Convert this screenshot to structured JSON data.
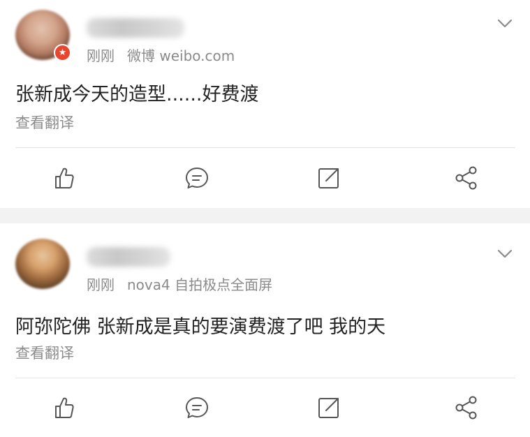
{
  "posts": [
    {
      "username": "",
      "time": "刚刚",
      "source": "微博 weibo.com",
      "text": "张新成今天的造型......好费渡",
      "translate_label": "查看翻译",
      "avatar_badge": "★",
      "icons": {
        "dropdown": "chevron-down-icon",
        "like": "thumbs-up-icon",
        "comment": "comment-bubble-icon",
        "repost": "repost-icon",
        "share": "share-icon"
      }
    },
    {
      "username": "",
      "time": "刚刚",
      "source": "nova4 自拍极点全面屏",
      "text": "阿弥陀佛 张新成是真的要演费渡了吧 我的天",
      "translate_label": "查看翻译",
      "icons": {
        "dropdown": "chevron-down-icon",
        "like": "thumbs-up-icon",
        "comment": "comment-bubble-icon",
        "repost": "repost-icon",
        "share": "share-icon"
      }
    }
  ],
  "colors": {
    "text_primary": "#222222",
    "text_secondary": "#8a8a8a",
    "icon": "#555555",
    "separator": "#f2f2f2",
    "badge": "#e8452f"
  }
}
